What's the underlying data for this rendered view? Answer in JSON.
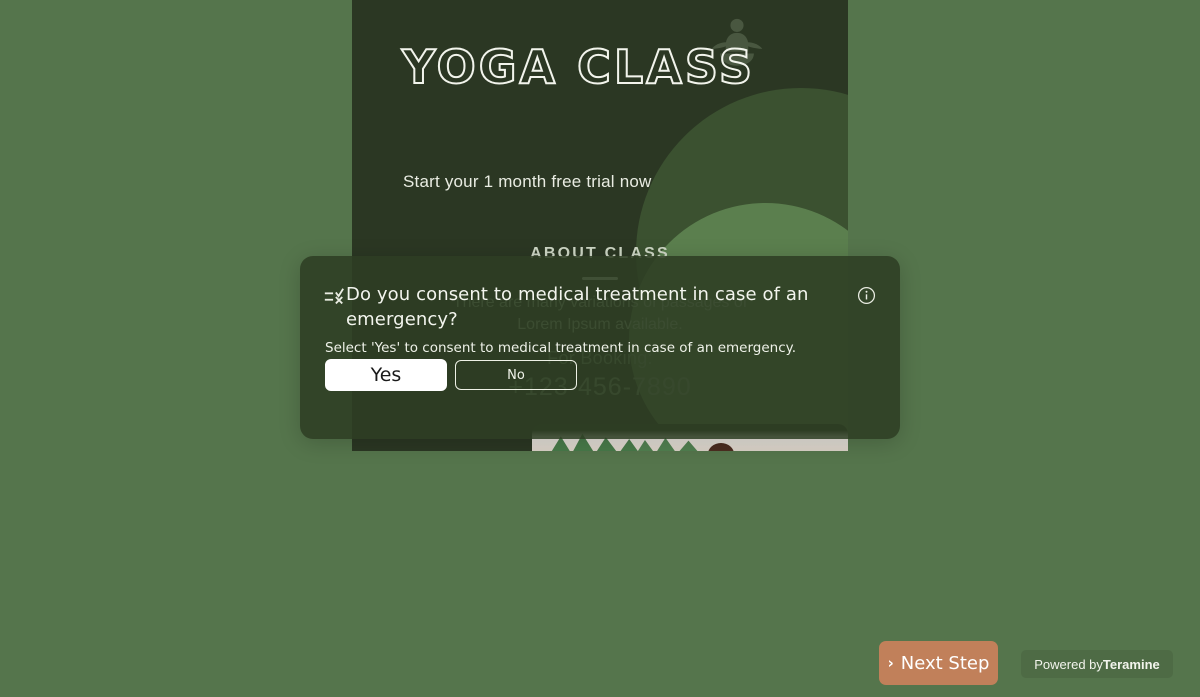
{
  "colors": {
    "page_background": "#55754c",
    "poster_background": "#2b3723",
    "poster_circle_dark": "#3b5130",
    "poster_circle_light": "#5b7f4e",
    "overlay_background": "rgba(45, 61, 35, 0.88)",
    "next_step_button": "#c1805a",
    "powered_badge": "#4e6b45",
    "selected_option_background": "#ffffff",
    "text_light": "#f3f5ee"
  },
  "poster": {
    "title": "YOGA CLASS",
    "subtitle": "Start your 1 month free trial now",
    "about_heading": "ABOUT CLASS",
    "about_body": "There are many variations of passages of Lorem Ipsum available.",
    "booking_label": "For Booking:",
    "booking_phone": "+123-456-7890",
    "figure_icon": "yoga-meditation-figure-icon",
    "photo_alt": "class-photo-strip"
  },
  "question": {
    "type_icon": "multiple-choice-icon",
    "info_icon": "info-circle-icon",
    "title": "Do you consent to medical treatment in case of an emergency?",
    "help_text": "Select 'Yes' to consent to medical treatment in case of an emergency.",
    "options": [
      {
        "label": "Yes",
        "selected": true
      },
      {
        "label": "No",
        "selected": false
      }
    ]
  },
  "footer": {
    "next_step_label": "Next Step",
    "next_step_chevron": "›",
    "powered_by_prefix": "Powered by",
    "powered_by_brand": "Teramine"
  }
}
